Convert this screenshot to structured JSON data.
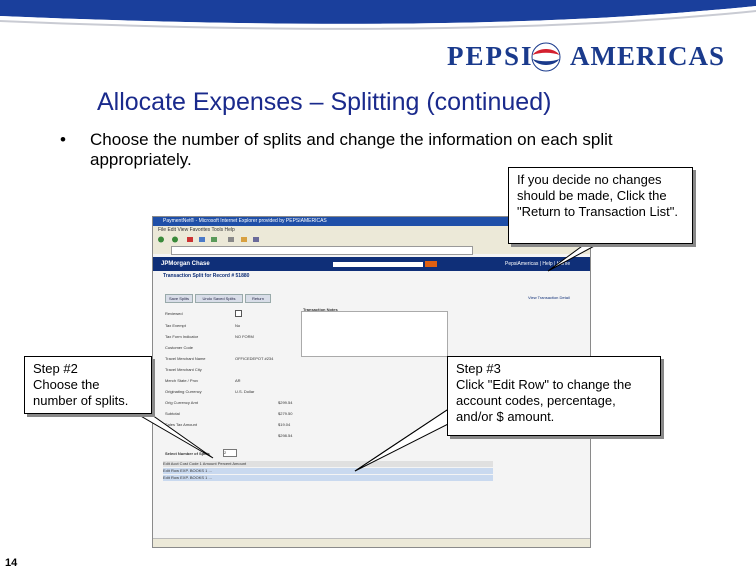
{
  "colors": {
    "brand_blue": "#1a3a8c",
    "pepsi_red": "#d4202f",
    "jp_navy": "#0f2f78"
  },
  "logo": {
    "pepsi": "PEPSI",
    "americas": "AMERICAS"
  },
  "slide": {
    "title": "Allocate Expenses – Splitting (continued)",
    "bullet_glyph": "•",
    "bullet": "Choose the number of splits and change the information on each split appropriately.",
    "number": "14"
  },
  "callouts": {
    "return": "If you decide no changes should be made, Click the \"Return to Transaction List\".",
    "step2": {
      "heading": "Step #2",
      "body": "Choose the number of splits."
    },
    "step3": {
      "heading": "Step #3",
      "body": "Click \"Edit Row\" to change the account codes, percentage, and/or $ amount."
    }
  },
  "screenshot": {
    "window_title": "PaymentNet® - Microsoft Internet Explorer provided by PEPSIAMERICAS",
    "menu": "File   Edit   View   Favorites   Tools   Help",
    "jp_brand": "JPMorgan Chase",
    "jp_nav": "PepsiAmericas | Help | Home",
    "page_header": "Transaction Split for Record # 51880",
    "buttons": [
      "Save Splits",
      "Undo Saved Splits",
      "Return"
    ],
    "notes_label": "Transaction Notes",
    "fields": [
      {
        "label": "Reviewed",
        "value": ""
      },
      {
        "label": "Tax Exempt",
        "value": "No"
      },
      {
        "label": "Tax Form Indicator",
        "value": "NO FORM"
      },
      {
        "label": "Customer Code",
        "value": ""
      },
      {
        "label": "Travel Merchant Name",
        "value": "OFFICEDEPOT #234"
      },
      {
        "label": "Travel Merchant City",
        "value": ""
      },
      {
        "label": "Merch State / Prov",
        "value": "AR"
      },
      {
        "label": "Originating Currency",
        "value": "U.S. Dollar"
      },
      {
        "label": "Orig Currency Amt",
        "value": "$299.54"
      },
      {
        "label": "Subtotal",
        "value": "$279.50"
      },
      {
        "label": "Sales Tax Amount",
        "value": "$19.04"
      },
      {
        "label": "",
        "value": "$298.54"
      }
    ],
    "split_label": "Select Number of Splits",
    "split_value": "2",
    "grid_header": "Edit   Acct Cost Code 1   Amount   Percent   Amount",
    "grid_rows": [
      "Edit Row   EXP. BOOKS 1   ...",
      "Edit Row   EXP. BOOKS 1   ..."
    ],
    "view_link": "View Transaction Detail"
  }
}
